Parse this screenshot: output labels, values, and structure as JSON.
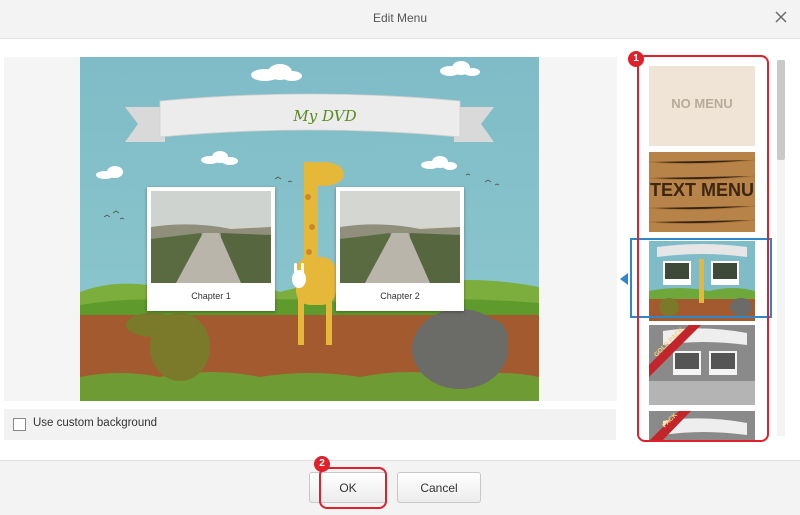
{
  "window": {
    "title": "Edit Menu"
  },
  "preview": {
    "menu_title": "My DVD",
    "chapters": [
      {
        "label": "Chapter 1"
      },
      {
        "label": "Chapter 2"
      }
    ]
  },
  "background_option": {
    "label": "Use custom background",
    "checked": false
  },
  "templates": [
    {
      "label": "NO MENU",
      "selected": false
    },
    {
      "label": "TEXT MENU",
      "selected": false
    },
    {
      "label": "",
      "selected": true
    },
    {
      "label": "",
      "ribbon": "GOLD PACK",
      "selected": false
    },
    {
      "label": "",
      "ribbon": "PACK",
      "selected": false
    }
  ],
  "annotations": {
    "step1": "1",
    "step2": "2"
  },
  "buttons": {
    "ok": "OK",
    "cancel": "Cancel"
  },
  "colors": {
    "accent": "#2f86c9",
    "annotation": "#e0202a",
    "ribbon": "#c4252a"
  }
}
